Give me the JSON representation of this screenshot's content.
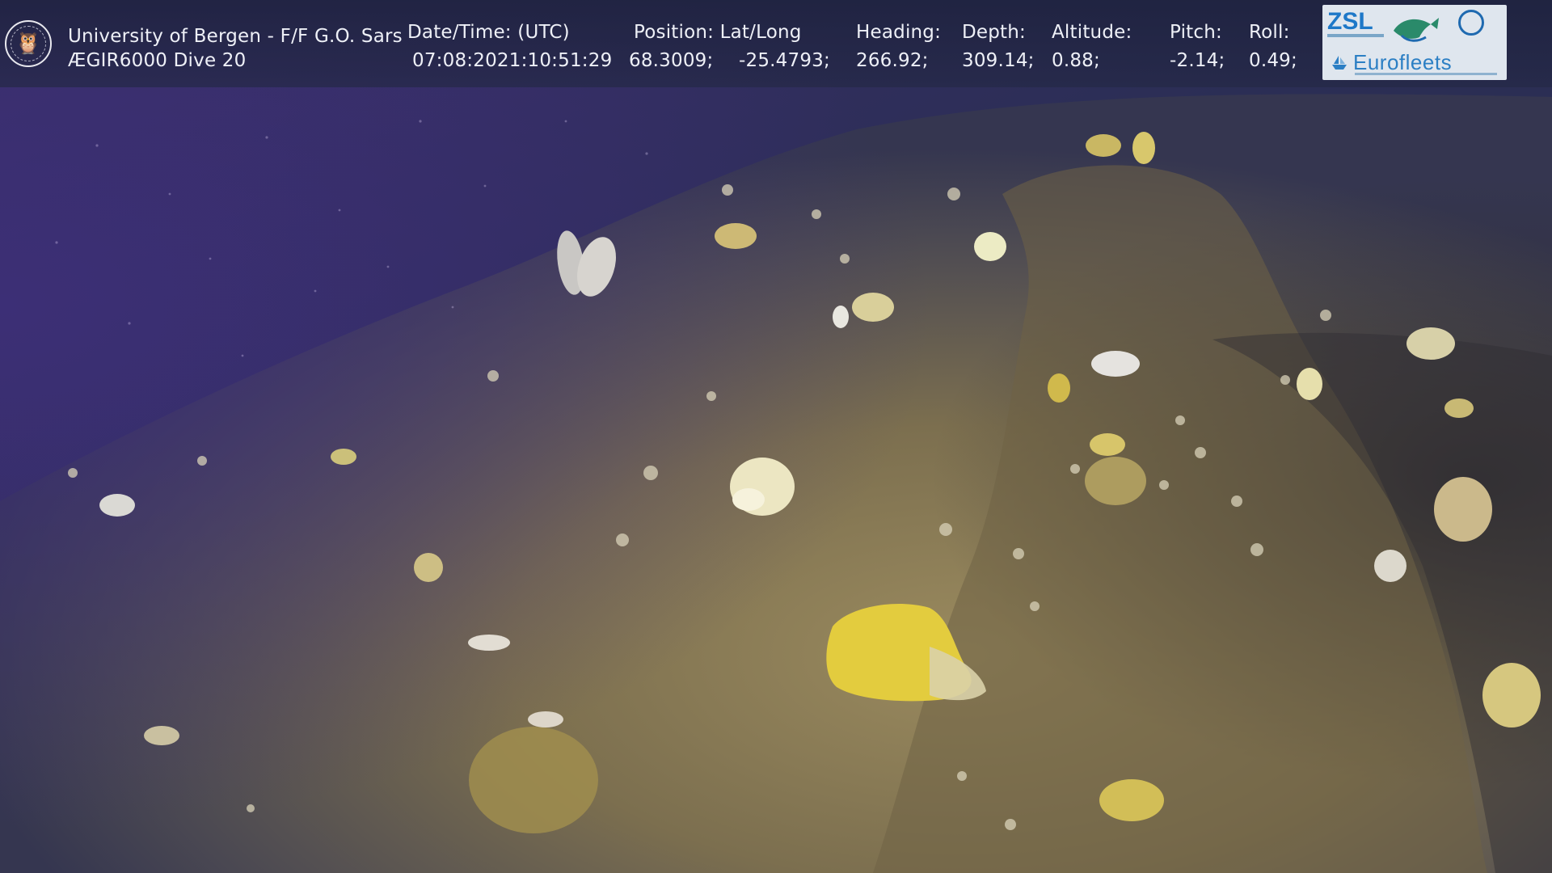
{
  "overlay": {
    "institution": "University of Bergen - F/F G.O. Sars",
    "dive": "ÆGIR6000 Dive 20",
    "datetime_label": "Date/Time: (UTC)",
    "datetime_value": "07:08:2021:10:51:29",
    "position_label": "Position: Lat/Long",
    "latitude": "68.3009;",
    "longitude": "-25.4793;",
    "heading_label": "Heading:",
    "heading_value": "266.92;",
    "depth_label": "Depth:",
    "depth_value": "309.14;",
    "altitude_label": "Altitude:",
    "altitude_value": "0.88;",
    "pitch_label": "Pitch:",
    "pitch_value": "-2.14;",
    "roll_label": "Roll:",
    "roll_value": "0.49;"
  },
  "logos": {
    "left_logo": "university-of-bergen-seal",
    "zsl_text": "ZSL",
    "eurofleets_text": "Eurofleets",
    "partner_logos": [
      "zsl-logo",
      "marine-freshwater-research-institute-logo",
      "eurofleets-logo"
    ]
  },
  "colors": {
    "overlay_bg": "#1e223e",
    "overlay_text": "#eef0f7",
    "seafloor": "#7b6f4f",
    "water": "#2c2a52",
    "sponge_yellow": "#e8cf3c"
  }
}
